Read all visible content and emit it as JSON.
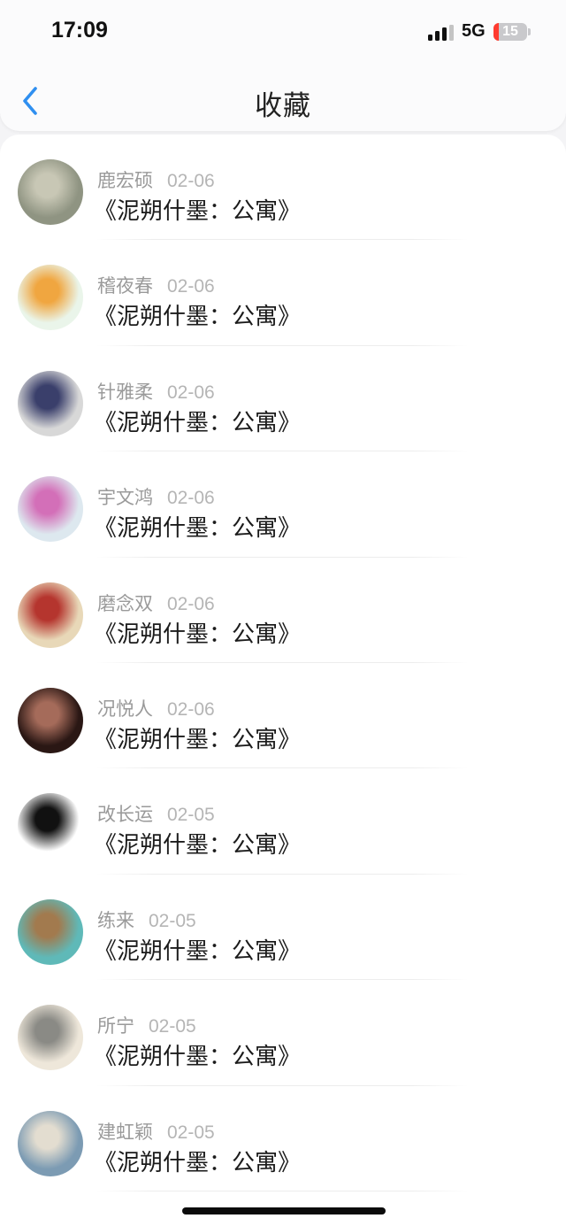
{
  "status_bar": {
    "time": "17:09",
    "network": "5G",
    "battery": "15"
  },
  "header": {
    "title": "收藏",
    "back_icon": "chevron-left-icon",
    "accent_color": "#2f8ff0"
  },
  "list": {
    "items": [
      {
        "user": "鹿宏硕",
        "date": "02-06",
        "title": "《泥朔什墨：公寓》",
        "avatar_colors": [
          "#8f9482",
          "#c8c7b5"
        ]
      },
      {
        "user": "稽夜春",
        "date": "02-06",
        "title": "《泥朔什墨：公寓》",
        "avatar_colors": [
          "#eaf5ea",
          "#f0a640"
        ]
      },
      {
        "user": "针雅柔",
        "date": "02-06",
        "title": "《泥朔什墨：公寓》",
        "avatar_colors": [
          "#d8d8d8",
          "#3a3f6b"
        ]
      },
      {
        "user": "宇文鸿",
        "date": "02-06",
        "title": "《泥朔什墨：公寓》",
        "avatar_colors": [
          "#dde8ef",
          "#d36fb8"
        ]
      },
      {
        "user": "磨念双",
        "date": "02-06",
        "title": "《泥朔什墨：公寓》",
        "avatar_colors": [
          "#e8d8b8",
          "#b5352e"
        ]
      },
      {
        "user": "况悦人",
        "date": "02-06",
        "title": "《泥朔什墨：公寓》",
        "avatar_colors": [
          "#2a1714",
          "#a56b5a"
        ]
      },
      {
        "user": "改长运",
        "date": "02-05",
        "title": "《泥朔什墨：公寓》",
        "avatar_colors": [
          "#ffffff",
          "#111111"
        ]
      },
      {
        "user": "练来",
        "date": "02-05",
        "title": "《泥朔什墨：公寓》",
        "avatar_colors": [
          "#5fb9b8",
          "#a27a4e"
        ]
      },
      {
        "user": "所宁",
        "date": "02-05",
        "title": "《泥朔什墨：公寓》",
        "avatar_colors": [
          "#eee7da",
          "#8a8a85"
        ]
      },
      {
        "user": "建虹颖",
        "date": "02-05",
        "title": "《泥朔什墨：公寓》",
        "avatar_colors": [
          "#7c9bb3",
          "#e3ddd0"
        ]
      }
    ]
  }
}
